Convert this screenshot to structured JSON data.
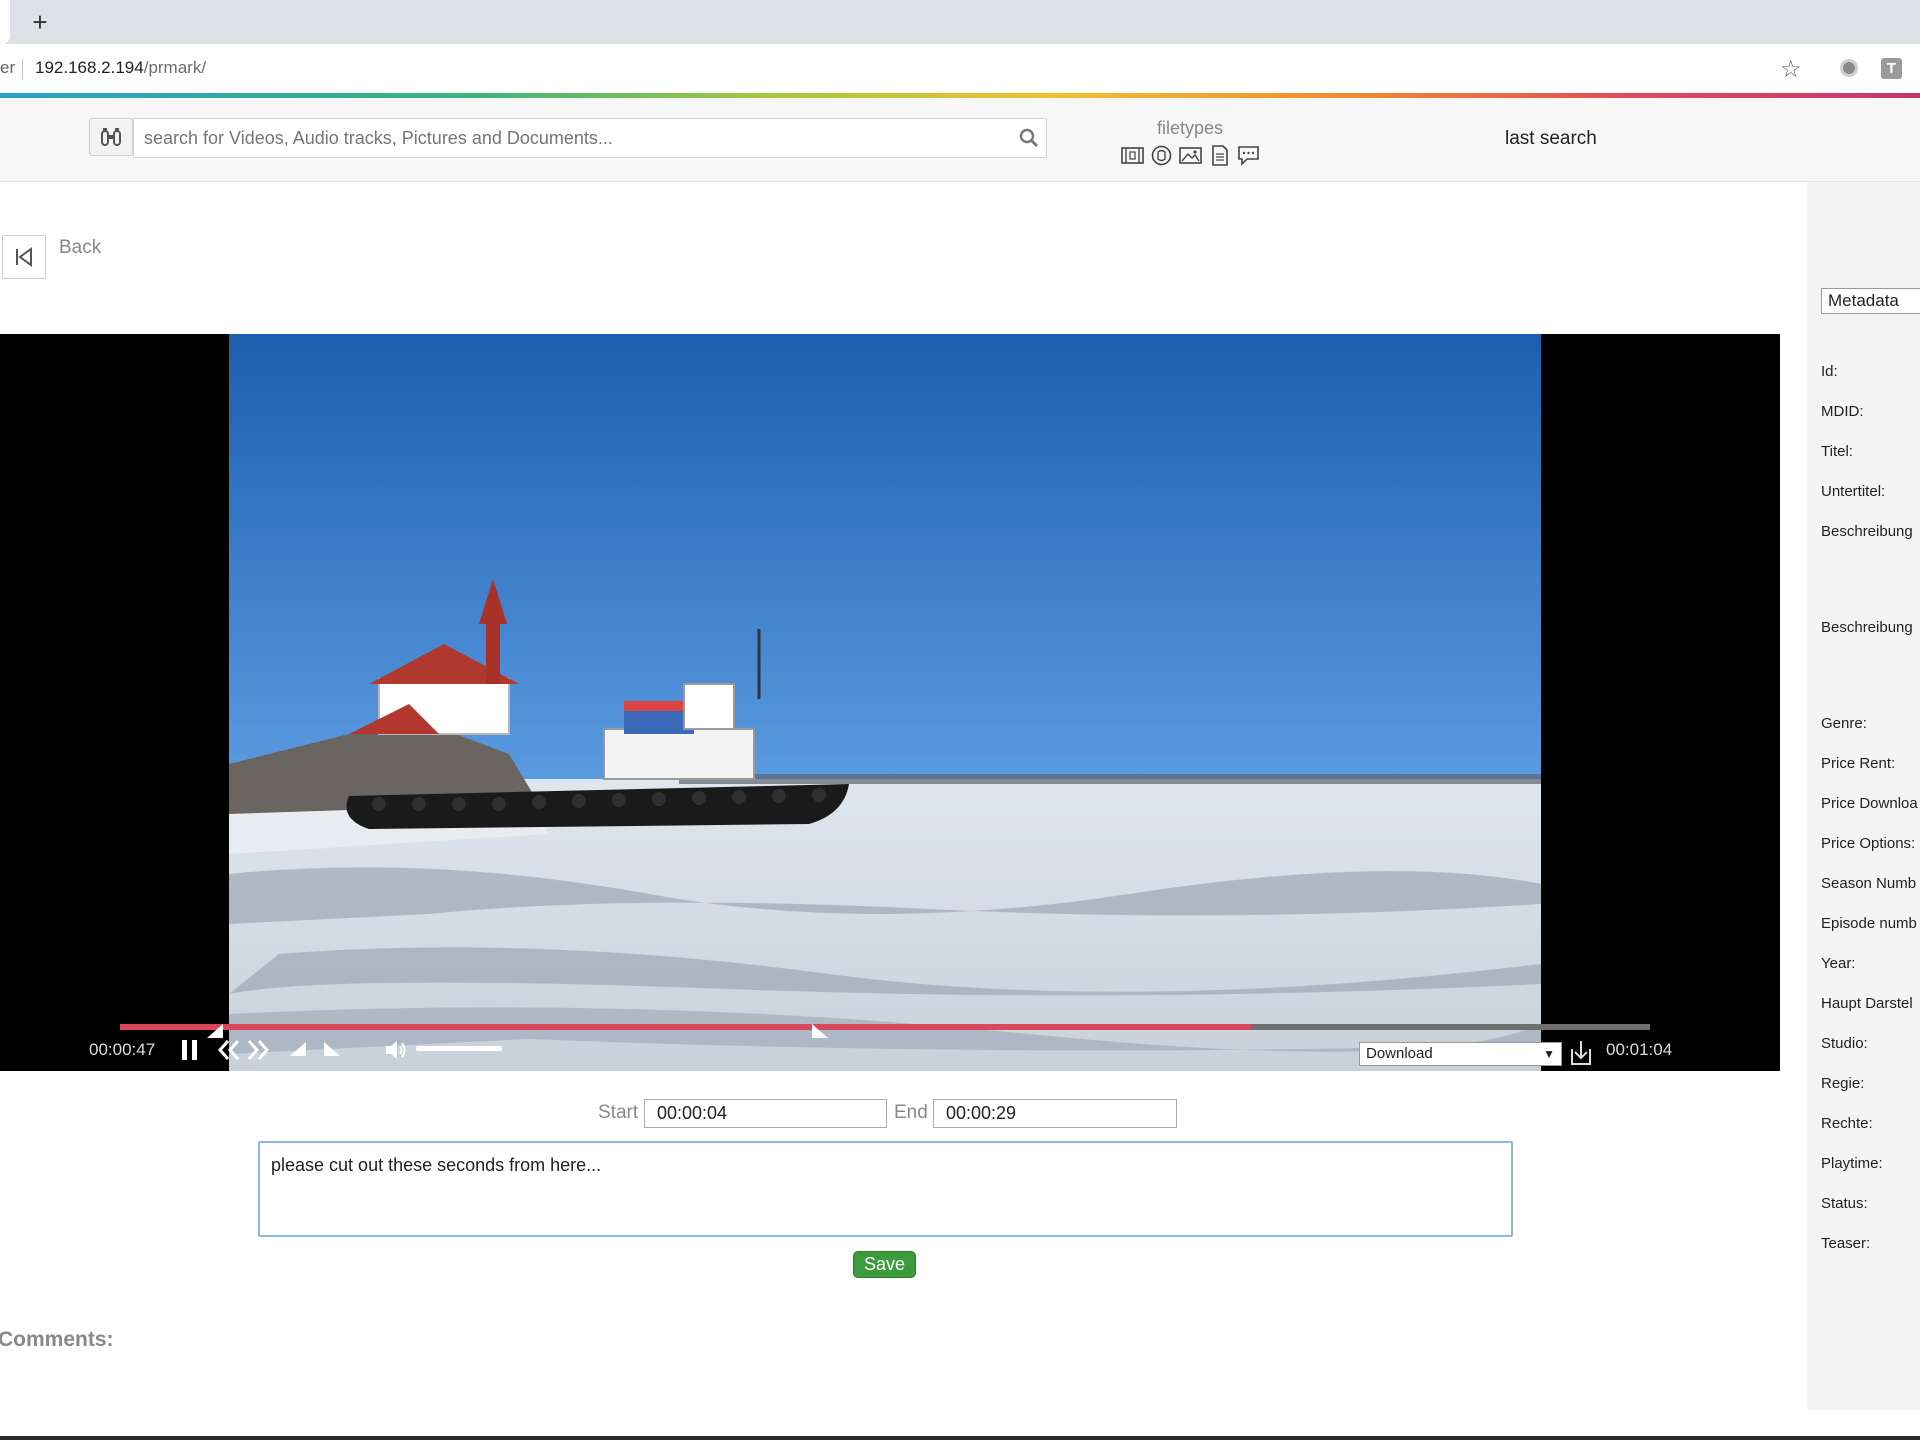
{
  "browser": {
    "new_tab": "+",
    "address_prefix": "er",
    "address_host": "192.168.2.194",
    "address_path": "/prmark/"
  },
  "header": {
    "search_placeholder": "search for Videos, Audio tracks, Pictures and Documents...",
    "filetypes_label": "filetypes",
    "filetype_icons": [
      "video-icon",
      "audio-icon",
      "picture-icon",
      "document-icon",
      "comment-icon"
    ],
    "last_search": "last search"
  },
  "nav": {
    "back_label": "Back"
  },
  "player": {
    "current_time": "00:00:47",
    "total_time": "00:01:04",
    "progress": 0.739,
    "volume": 1.0,
    "download_option": "Download",
    "download_arrow": "▼"
  },
  "cut_form": {
    "start_label": "Start",
    "start_value": "00:00:04",
    "end_label": "End",
    "end_value": "00:00:29",
    "comment_text": "please cut out these seconds from here...",
    "save_label": "Save"
  },
  "comments": {
    "label": "Comments:"
  },
  "metadata_panel": {
    "select_value": "Metadata",
    "fields": [
      "Id:",
      "MDID:",
      "Titel:",
      "Untertitel:",
      "Beschreibung",
      "Beschreibung",
      "Genre:",
      "Price Rent:",
      "Price Downloa",
      "Price Options:",
      "Season Numb",
      "Episode numb",
      "Year:",
      "Haupt Darstel",
      "Studio:",
      "Regie:",
      "Rechte:",
      "Playtime:",
      "Status:",
      "Teaser:"
    ]
  },
  "colors": {
    "progress": "#d9475a",
    "save": "#3d9b3d",
    "textarea_border": "#8fb4e8"
  }
}
